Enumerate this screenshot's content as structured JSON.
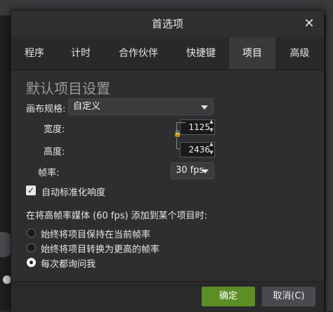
{
  "dialog": {
    "title": "首选项",
    "close_icon": "✕"
  },
  "tabs": [
    {
      "label": "程序",
      "active": false
    },
    {
      "label": "计时",
      "active": false
    },
    {
      "label": "合作伙伴",
      "active": false
    },
    {
      "label": "快捷键",
      "active": false
    },
    {
      "label": "项目",
      "active": true
    },
    {
      "label": "高级",
      "active": false
    }
  ],
  "project": {
    "section_title": "默认项目设置",
    "canvas_label": "画布规格:",
    "canvas_value": "自定义",
    "width_label": "宽度:",
    "width_value": "1125",
    "height_label": "高度:",
    "height_value": "2436",
    "framerate_label": "帧率:",
    "framerate_value": "30 fps",
    "normalize_label": "自动标准化响度",
    "normalize_checked": true,
    "highfps_prompt": "在将高帧率媒体 (60 fps) 添加到某个项目时:",
    "options": [
      {
        "label": "始终将项目保持在当前帧率",
        "checked": false
      },
      {
        "label": "始终将项目转换为更高的帧率",
        "checked": false
      },
      {
        "label": "每次都询问我",
        "checked": true
      }
    ]
  },
  "footer": {
    "ok_label": "确定",
    "cancel_label": "取消(C)"
  },
  "colors": {
    "accent_green": "#5d8e25",
    "dialog_bg": "#2e2e30"
  }
}
